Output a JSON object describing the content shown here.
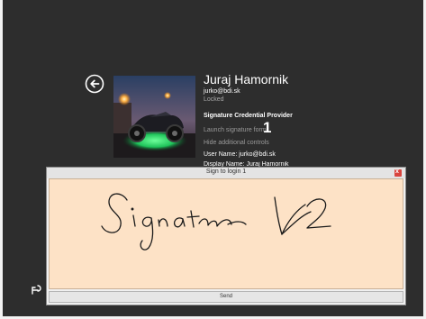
{
  "user": {
    "name": "Juraj Hamornik",
    "email": "jurko@bdi.sk",
    "status": "Locked"
  },
  "credential": {
    "provider": "Signature Credential Provider",
    "launch_label": "Launch signature form",
    "launch_marker": "1",
    "hide_label": "Hide additional controls",
    "user_name_line": "User Name: jurko@bdi.sk",
    "display_name_line": "Display Name: Juraj Hamornik"
  },
  "dialog": {
    "title": "Sign to login 1",
    "close_label": "x",
    "send_label": "Send"
  },
  "icons": {
    "back": "back-arrow-icon",
    "ease_of_access": "ease-of-access-icon",
    "close": "close-icon"
  },
  "colors": {
    "background": "#2d2d2d",
    "signature_pad": "#fde2c6",
    "close_button": "#d9453e"
  }
}
